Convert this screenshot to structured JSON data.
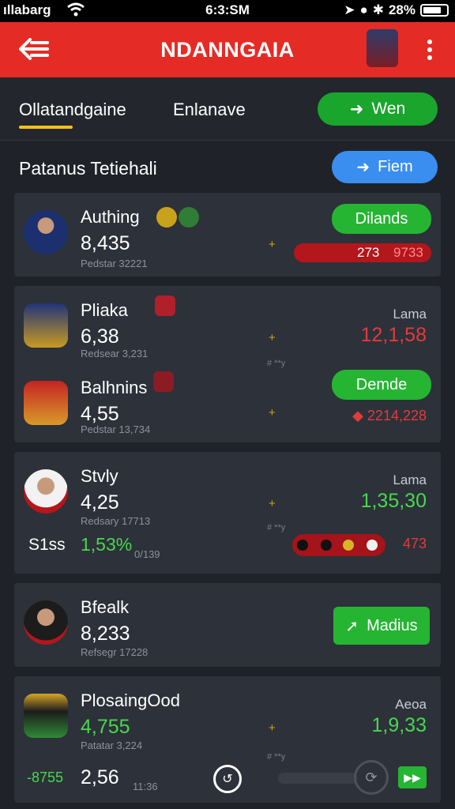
{
  "status_bar": {
    "carrier": "ıllabarg",
    "time": "6:3:SM",
    "battery": "28%"
  },
  "app_bar": {
    "title": "NDANNGAIA"
  },
  "tabs": {
    "tab_1": "Ollatandgaine",
    "tab_2": "Enlanave",
    "action_label": "Wen"
  },
  "section": {
    "title": "Patanus Tetiehali",
    "button_label": "Fiem"
  },
  "cards": [
    {
      "items": [
        {
          "name": "Authing",
          "value": "8,435",
          "sub": "Pedstar 32221",
          "action_label": "Dilands",
          "bar_left": "273",
          "bar_right": "9733"
        }
      ]
    },
    {
      "items": [
        {
          "name": "Pliaka",
          "value": "6,38",
          "sub": "Redsear 3,231",
          "right_label": "Lama",
          "right_value": "12,1,58",
          "small_note": "# **y"
        },
        {
          "name": "Balhnins",
          "value": "4,55",
          "sub": "Pedstar 13,734",
          "action_label": "Demde",
          "right_value": "2214,228"
        }
      ]
    },
    {
      "items": [
        {
          "name": "Stvly",
          "value": "4,25",
          "sub": "Redsary 17713",
          "right_label": "Lama",
          "right_value": "1,35,30",
          "small_note": "# **y"
        }
      ],
      "extra": {
        "label": "S1ss",
        "value": "1,53%",
        "sub": "0/139",
        "right_value": "473"
      }
    },
    {
      "items": [
        {
          "name": "Bfealk",
          "value": "8,233",
          "sub": "Refsegr 17228",
          "action_label": "Madius"
        }
      ]
    },
    {
      "items": [
        {
          "name": "PlosaingOod",
          "value": "4,755",
          "sub": "Patatar 3,224",
          "right_label": "Aeoa",
          "right_value": "1,9,33",
          "small_note": "# **y"
        }
      ],
      "extra": {
        "label": "-8755",
        "value": "2,56",
        "sub": "11:36"
      }
    }
  ],
  "colors": {
    "app_bar": "#e52b25",
    "green": "#25b533",
    "blue": "#3a8ef0",
    "red": "#e23b3b",
    "gold": "#f2c21a"
  }
}
